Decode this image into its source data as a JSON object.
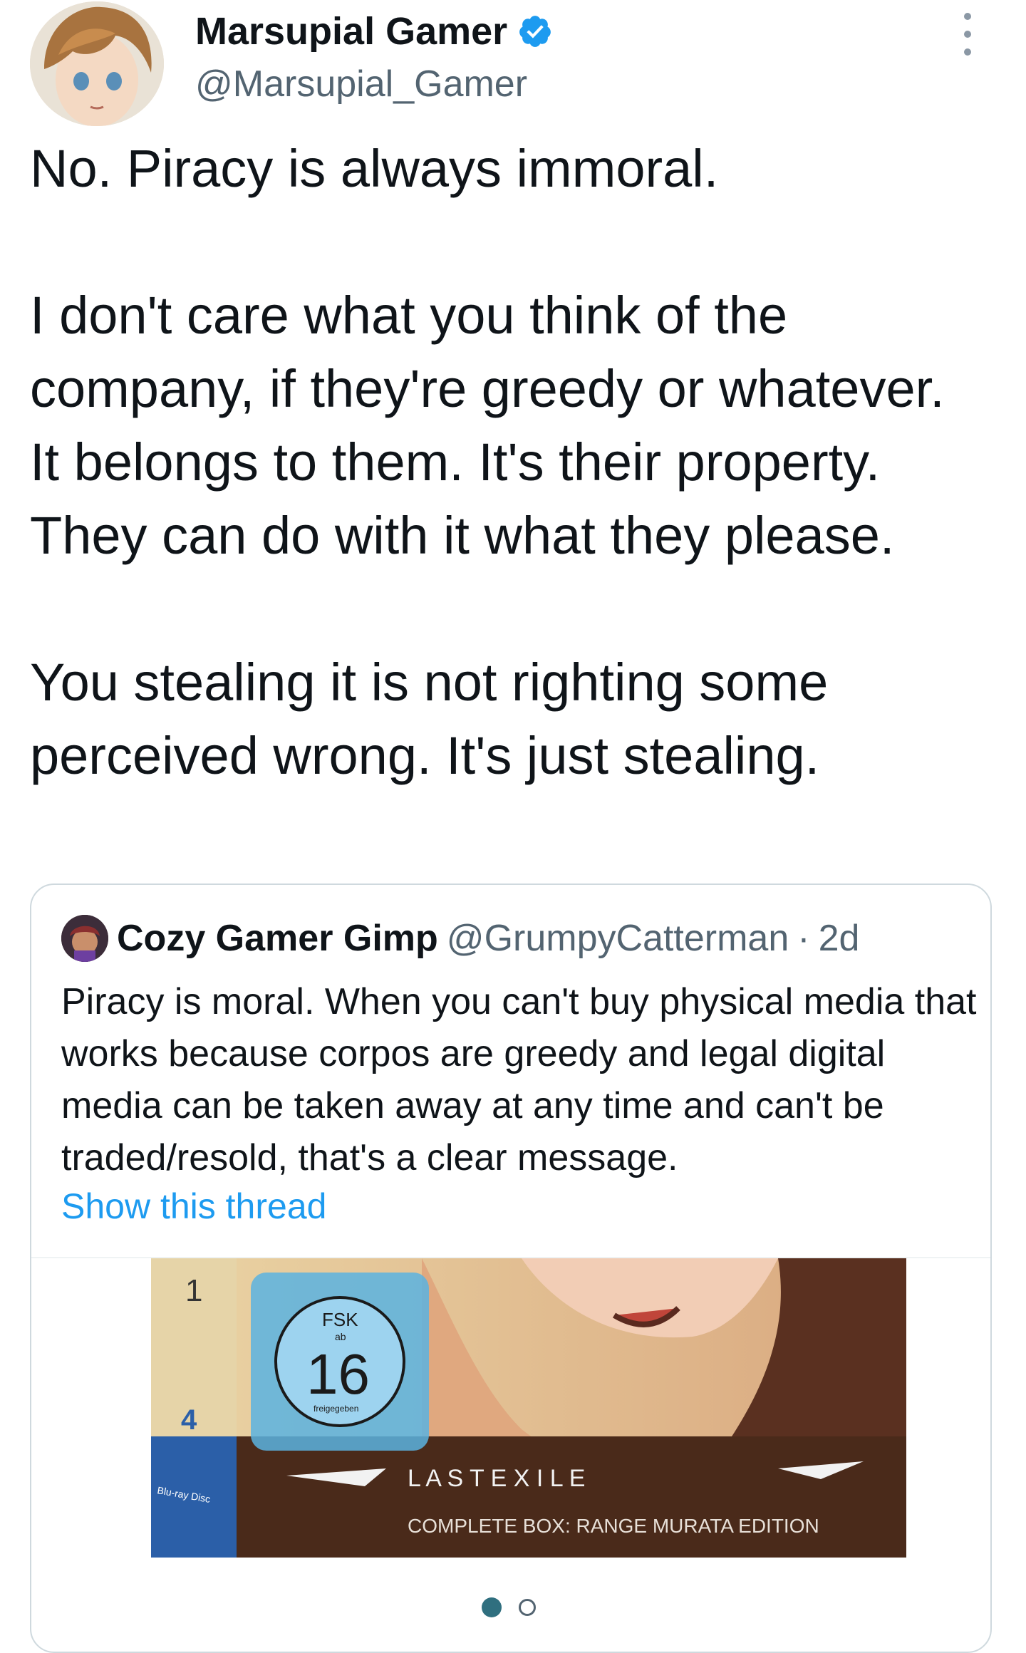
{
  "tweet": {
    "author_name": "Marsupial Gamer",
    "author_handle": "@Marsupial_Gamer",
    "verified": true,
    "paragraphs": [
      "No.  Piracy is always immoral.",
      "I don't care what you think of the company, if they're greedy or whatever.  It belongs to them.  It's their property.  They can do with it what they please.",
      "You stealing it is not righting some perceived wrong.  It's just stealing."
    ]
  },
  "quote": {
    "author_name": "Cozy Gamer Gimp",
    "author_handle": "@GrumpyCatterman",
    "separator": "·",
    "time": "2d",
    "text": "Piracy is moral. When you can't buy physical media that works because corpos are greedy and legal digital media can be taken away at any time and can't be traded/resold, that's a clear message.",
    "show_thread": "Show this thread",
    "media": {
      "fsk_label": "FSK",
      "fsk_ab": "ab",
      "fsk_age": "16",
      "fsk_sub": "freigegeben",
      "spine_number_top": "1",
      "spine_number": "4",
      "spine_format": "Blu-ray Disc",
      "title": "L A S T  E X I L E",
      "subtitle": "COMPLETE BOX: RANGE MURATA EDITION"
    },
    "carousel": {
      "count": 2,
      "active": 1
    }
  },
  "colors": {
    "text": "#0f1419",
    "secondary": "#536471",
    "link": "#1d9bf0",
    "verified": "#1d9bf0",
    "border": "#cfd9de"
  },
  "icons": {
    "verified": "verified-badge-icon",
    "more": "more-options-icon"
  }
}
